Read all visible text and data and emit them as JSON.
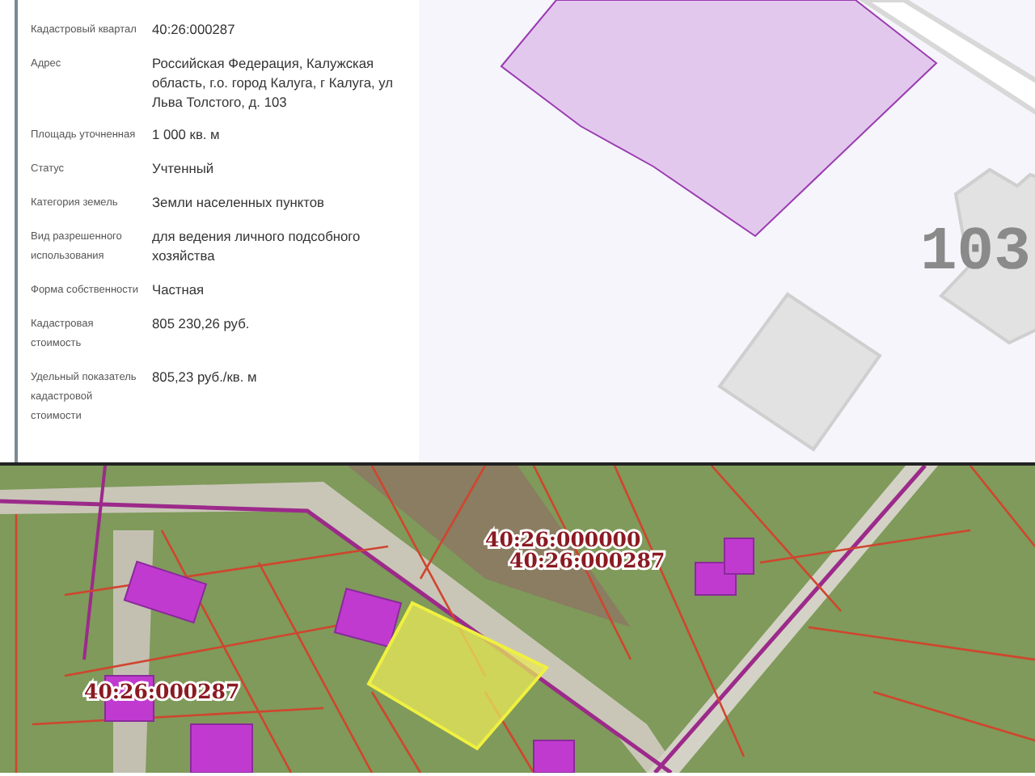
{
  "details": [
    {
      "label": "Кадастровый квартал",
      "value": "40:26:000287"
    },
    {
      "label": "Адрес",
      "value": "Российская Федерация, Калужская область, г.о. город Калуга, г Калуга, ул Льва Толстого, д. 103"
    },
    {
      "label": "Площадь уточненная",
      "value": "1 000 кв. м"
    },
    {
      "label": "Статус",
      "value": "Учтенный"
    },
    {
      "label": "Категория земель",
      "value": "Земли населенных пунктов"
    },
    {
      "label": "Вид разрешенного использования",
      "value": "для ведения личного подсобного хозяйства"
    },
    {
      "label": "Форма собственности",
      "value": "Частная"
    },
    {
      "label": "Кадастровая стоимость",
      "value": "805 230,26 руб."
    },
    {
      "label": "Удельный показатель кадастровой стоимости",
      "value": "805,23 руб./кв. м"
    }
  ],
  "scheme_map": {
    "house_number": "103"
  },
  "satellite_map": {
    "labels": [
      {
        "text": "40:26:000000"
      },
      {
        "text": "40:26:000287"
      },
      {
        "text": "40:26:000287"
      }
    ]
  }
}
